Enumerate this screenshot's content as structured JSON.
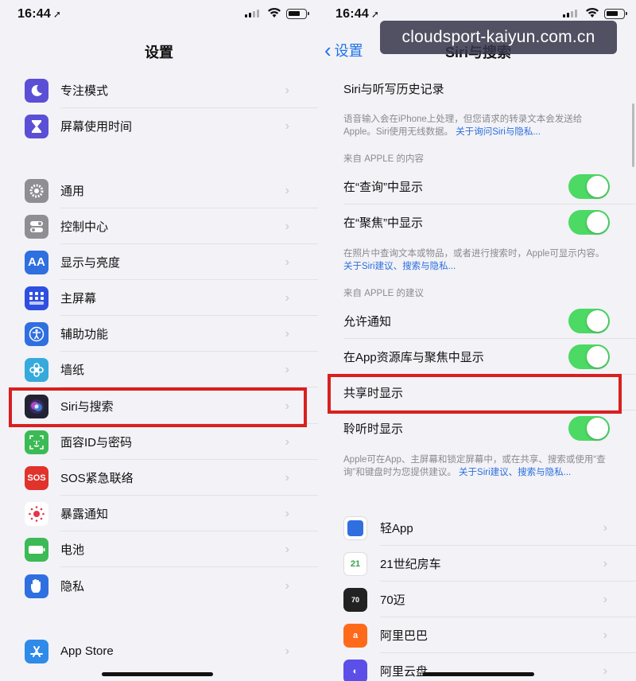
{
  "status": {
    "time": "16:44",
    "location_icon": "arrow-icon"
  },
  "left": {
    "title": "设置",
    "items": [
      {
        "label": "专注模式",
        "icon": "moon-icon",
        "color": "#5b4fd6"
      },
      {
        "label": "屏幕使用时间",
        "icon": "hourglass-icon",
        "color": "#5b4fd6"
      },
      {
        "label": "通用",
        "icon": "gear-icon",
        "color": "#8e8e93"
      },
      {
        "label": "控制中心",
        "icon": "toggles-icon",
        "color": "#8e8e93"
      },
      {
        "label": "显示与亮度",
        "icon": "AA",
        "color": "#2f6fe0"
      },
      {
        "label": "主屏幕",
        "icon": "grid-icon",
        "color": "#2f4fe0"
      },
      {
        "label": "辅助功能",
        "icon": "accessibility-icon",
        "color": "#2f6fe0"
      },
      {
        "label": "墙纸",
        "icon": "flower-icon",
        "color": "#37aadc"
      },
      {
        "label": "Siri与搜索",
        "icon": "siri-icon",
        "color": "#222233"
      },
      {
        "label": "面容ID与密码",
        "icon": "faceid-icon",
        "color": "#3cba55"
      },
      {
        "label": "SOS紧急联络",
        "icon": "SOS",
        "color": "#e0332b"
      },
      {
        "label": "暴露通知",
        "icon": "exposure-icon",
        "color": "#ffffff"
      },
      {
        "label": "电池",
        "icon": "battery-icon",
        "color": "#3cba55"
      },
      {
        "label": "隐私",
        "icon": "hand-icon",
        "color": "#2f6fe0"
      },
      {
        "label": "App Store",
        "icon": "appstore-icon",
        "color": "#2f8ae8"
      }
    ]
  },
  "right": {
    "back_label": "设置",
    "title": "Siri与搜索",
    "siri_history": "Siri与听写历史记录",
    "footer1_text": "语音输入会在iPhone上处理，但您请求的转录文本会发送给Apple。Siri使用无线数据。",
    "footer1_link": "关于询问Siri与隐私...",
    "section1": "来自 APPLE 的内容",
    "show_in_lookup": "在“查询”中显示",
    "show_in_spotlight": "在“聚焦”中显示",
    "footer2_text": "在照片中查询文本或物品，或者进行搜索时，Apple可显示内容。",
    "footer2_link": "关于Siri建议、搜索与隐私...",
    "section2": "来自 APPLE 的建议",
    "allow_notifications": "允许通知",
    "show_in_library": "在App资源库与聚焦中显示",
    "show_when_sharing": "共享时显示",
    "show_when_listening": "聆听时显示",
    "footer3_text": "Apple可在App、主屏幕和锁定屏幕中，或在共享、搜索或使用“查询”和键盘时为您提供建议。",
    "footer3_link": "关于Siri建议、搜索与隐私...",
    "apps": [
      {
        "label": "轻App",
        "icon": "square-icon",
        "color": "#2f6fe0"
      },
      {
        "label": "21世纪房车",
        "icon": "21rv-icon",
        "color": "#3aa04a"
      },
      {
        "label": "70迈",
        "icon": "70mai-icon",
        "color": "#222222"
      },
      {
        "label": "阿里巴巴",
        "icon": "alibaba-icon",
        "color": "#ff6a1a"
      },
      {
        "label": "阿里云盘",
        "icon": "cloud-icon",
        "color": "#5b4fe8"
      }
    ]
  },
  "watermark": "cloudsport-kaiyun.com.cn",
  "highlight_color": "#d91f1f",
  "toggle_color": "#4cd964"
}
